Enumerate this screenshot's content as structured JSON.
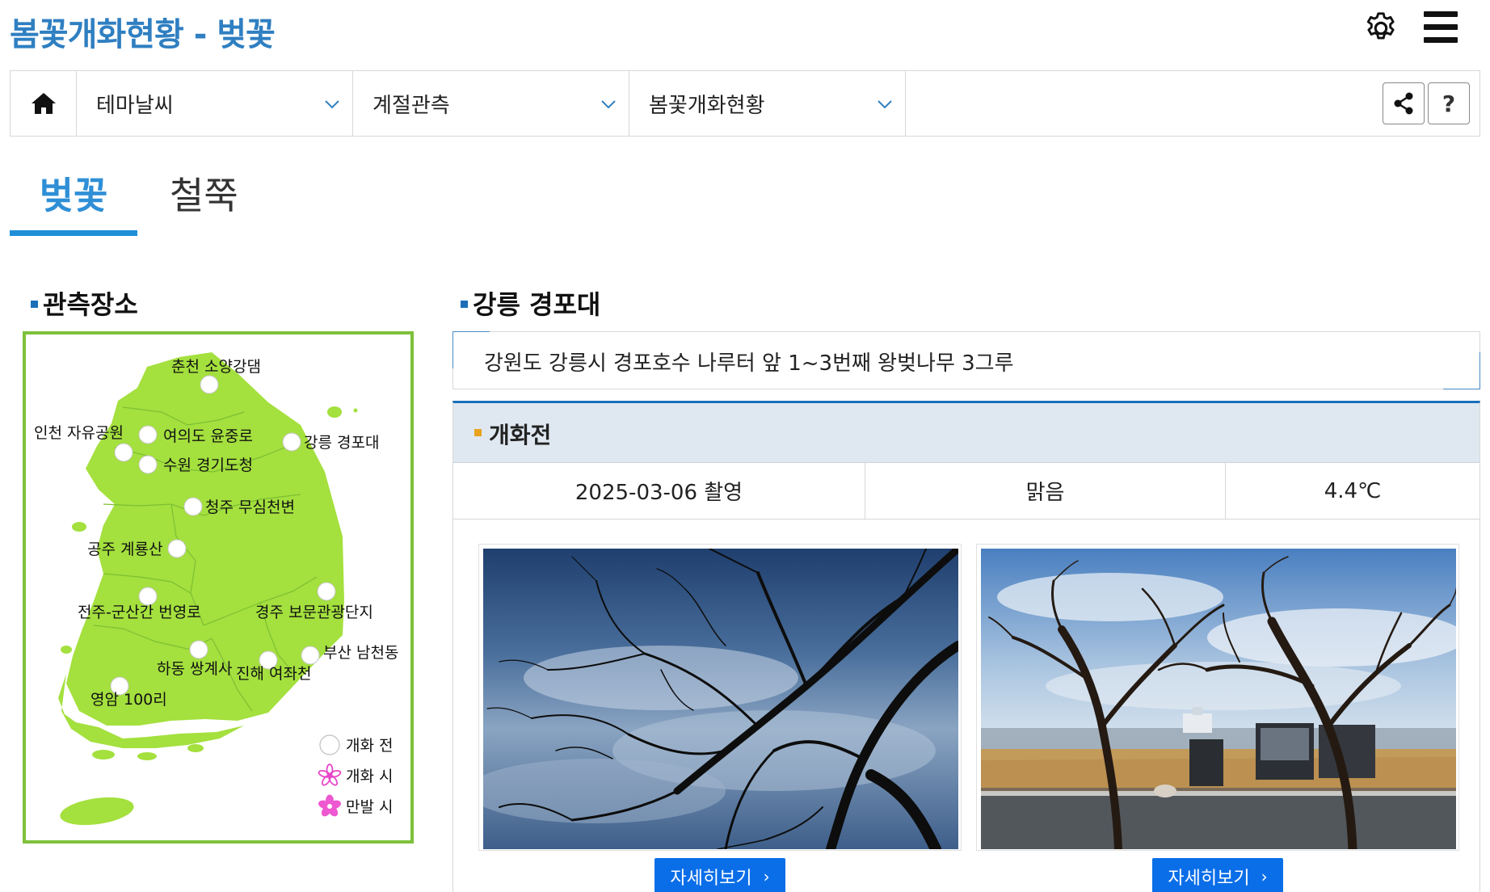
{
  "header": {
    "title": "봄꽃개화현황 - 벚꽃"
  },
  "nav": {
    "items": [
      {
        "label": "테마날씨"
      },
      {
        "label": "계절관측"
      },
      {
        "label": "봄꽃개화현황"
      }
    ],
    "help_label": "?"
  },
  "tabs": [
    {
      "label": "벚꽃",
      "active": true
    },
    {
      "label": "철쭉",
      "active": false
    }
  ],
  "left": {
    "section_title": "관측장소",
    "map": {
      "locations": [
        {
          "label": "춘천 소양강댐"
        },
        {
          "label": "인천 자유공원"
        },
        {
          "label": "여의도 윤중로"
        },
        {
          "label": "수원 경기도청"
        },
        {
          "label": "강릉 경포대"
        },
        {
          "label": "청주 무심천변"
        },
        {
          "label": "공주 계룡산"
        },
        {
          "label": "전주-군산간 번영로"
        },
        {
          "label": "경주 보문관광단지"
        },
        {
          "label": "부산 남천동"
        },
        {
          "label": "하동 쌍계사"
        },
        {
          "label": "진해 여좌천"
        },
        {
          "label": "영암 100리"
        }
      ],
      "legend": [
        {
          "label": "개화 전",
          "icon": "circle-icon"
        },
        {
          "label": "개화 시",
          "icon": "flower-outline-icon",
          "color": "#e845c8"
        },
        {
          "label": "만발 시",
          "icon": "flower-filled-icon",
          "color": "#e845c8"
        }
      ],
      "land_color": "#a4e03e",
      "border_color": "#7ec13a"
    }
  },
  "right": {
    "section_title": "강릉 경포대",
    "description": "강원도 강릉시 경포호수 나루터 앞 1~3번째 왕벚나무 3그루",
    "status": "개화전",
    "info": {
      "date": "2025-03-06 촬영",
      "weather": "맑음",
      "temperature": "4.4℃"
    },
    "photos": [
      {
        "button_label": "자세히보기"
      },
      {
        "button_label": "자세히보기"
      }
    ]
  },
  "colors": {
    "title_blue": "#2f7fc1",
    "tab_blue": "#1e8fd8",
    "button_blue": "#0a6ee8",
    "status_bg": "#dfe8f0",
    "status_marker": "#e8a21c"
  }
}
